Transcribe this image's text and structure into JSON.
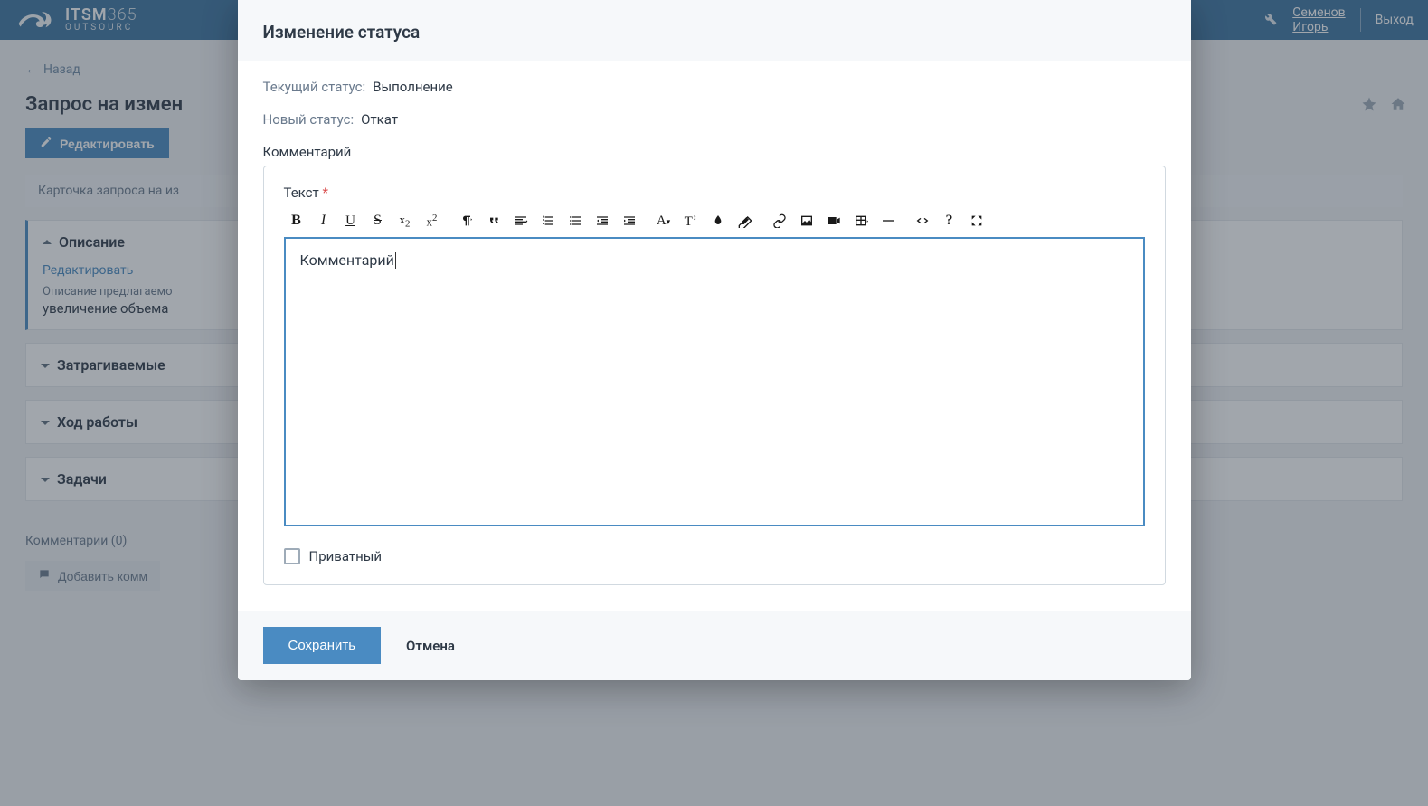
{
  "brand": {
    "name": "ITSM",
    "suffix": "365",
    "sub": "OUTSOURC"
  },
  "header": {
    "user_line1": "Семенов",
    "user_line2": "Игорь",
    "logout": "Выход"
  },
  "page": {
    "back": "Назад",
    "title": "Запрос на измен",
    "edit_btn": "Редактировать",
    "tab_caption": "Карточка запроса на из",
    "panels": {
      "description": {
        "title": "Описание",
        "edit_link": "Редактировать",
        "label": "Описание предлагаемо",
        "value": "увеличение объема"
      },
      "affected": {
        "title": "Затрагиваемые"
      },
      "progress": {
        "title": "Ход работы"
      },
      "tasks": {
        "title": "Задачи"
      }
    },
    "comments": {
      "label": "Комментарии (0)",
      "add_btn": "Добавить комм"
    }
  },
  "modal": {
    "title": "Изменение статуса",
    "current_status_label": "Текущий статус:",
    "current_status_value": "Выполнение",
    "new_status_label": "Новый статус:",
    "new_status_value": "Откат",
    "comment_caption": "Комментарий",
    "editor_label": "Текст",
    "editor_value": "Комментарий",
    "private_label": "Приватный",
    "save": "Сохранить",
    "cancel": "Отмена"
  }
}
